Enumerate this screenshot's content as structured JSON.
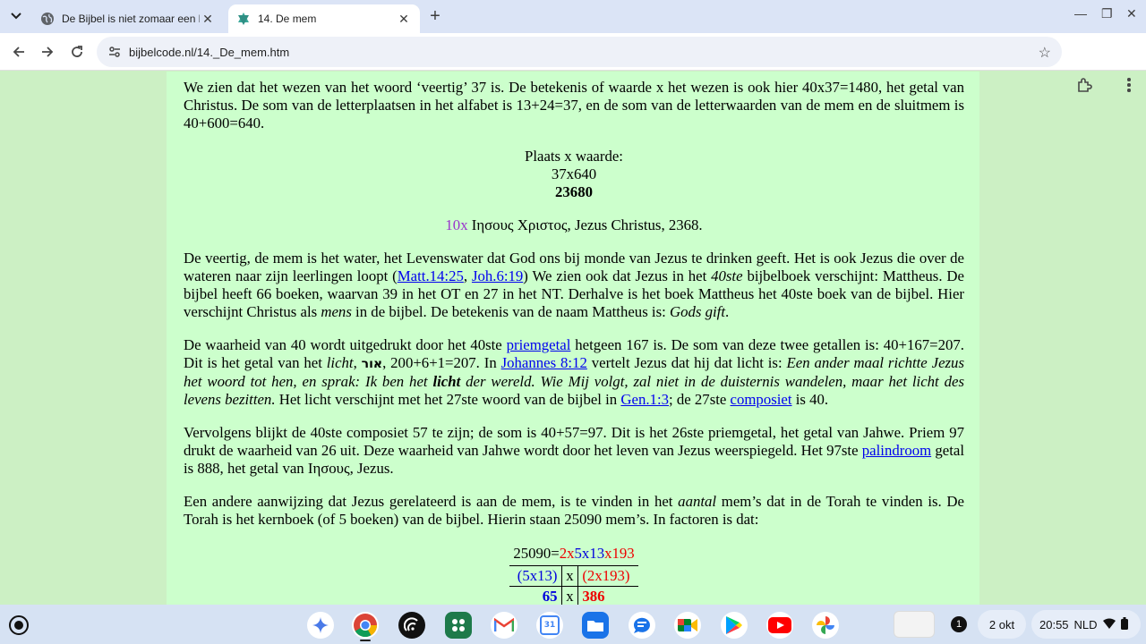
{
  "browser": {
    "tabs": [
      {
        "title": "De Bijbel is niet zomaar een boek"
      },
      {
        "title": "14. De mem"
      }
    ],
    "new_tab": "+",
    "url": "bijbelcode.nl/14._De_mem.htm"
  },
  "article": {
    "p1": "We zien dat het wezen van het woord ‘veertig’ 37 is. De betekenis of waarde x het wezen is ook hier 40x37=1480, het getal van Christus. De som van de letterplaatsen in het alfabet is 13+24=37, en de som van de letterwaarden van de mem en de sluitmem is 40+600=640.",
    "center1": {
      "line1": "Plaats x waarde:",
      "line2": "37x640",
      "line3": "23680"
    },
    "center2": {
      "prefix": "10x",
      "text": " Ιησους Χριστος, Jezus Christus, 2368."
    },
    "p2": {
      "t1": "De veertig, de mem is het water, het Levenswater dat God ons bij monde van Jezus te drinken geeft. Het is ook Jezus die over de wateren naar zijn leerlingen loopt (",
      "link1": "Matt.14:25",
      "t2": ", ",
      "link2": "Joh.6:19",
      "t3": ") We zien ook dat Jezus in het ",
      "em1": "40ste",
      "t4": " bijbelboek verschijnt: Mattheus. De bijbel heeft 66 boeken, waarvan 39 in het OT en 27 in het NT. Derhalve is het boek Mattheus het 40ste boek van de bijbel. Hier verschijnt Christus als ",
      "em2": "mens",
      "t5": " in de bijbel. De betekenis van de naam Mattheus is: ",
      "em3": "Gods gift",
      "t6": "."
    },
    "p3": {
      "t1": "De waarheid van 40 wordt uitgedrukt door het 40ste ",
      "link1": "priemgetal",
      "t2": " hetgeen 167 is. De som van deze twee getallen is: 40+167=207. Dit is het getal van het ",
      "em1": "licht",
      "t3": ", ",
      "hebrew": "אור",
      "t4": ", 200+6+1=207. In ",
      "link2": "Johannes 8:12",
      "t5": " vertelt Jezus dat hij dat licht is: ",
      "em2": "Een ander maal richtte Jezus het woord tot hen, en sprak: Ik ben het ",
      "strong": "licht",
      "em3": " der wereld. Wie Mij volgt, zal niet in de duisternis wandelen, maar het licht des levens bezitten.",
      "t6": " Het licht verschijnt met het 27ste woord van de bijbel in ",
      "link3": "Gen.1:3",
      "t7": "; de 27ste ",
      "link4": "composiet",
      "t8": " is 40."
    },
    "p4": {
      "t1": "Vervolgens blijkt de 40ste composiet 57 te zijn; de som is 40+57=97. Dit is het 26ste priemgetal, het getal van Jahwe. Priem 97 drukt de waarheid van 26 uit. Deze waarheid van Jahwe wordt door het leven van Jezus weerspiegeld. Het 97ste ",
      "link1": "palindroom",
      "t2": " getal is 888, het getal van Ιησους, Jezus."
    },
    "p5": {
      "t1": "Een andere aanwijzing dat Jezus gerelateerd is aan de mem, is te vinden in het ",
      "em1": "aantal",
      "t2": " mem’s dat in de Torah te vinden is. De Torah is het kernboek (of 5 boeken) van de bijbel. Hierin staan 25090 mem’s. In factoren is dat:"
    },
    "factor_table": {
      "top": {
        "a": "25090=",
        "b": "2x",
        "c": "5x13",
        "d": "x193"
      },
      "row2": {
        "left": "(5x13)",
        "mid": "x",
        "right": "(2x193)"
      },
      "row3": {
        "left": "65",
        "mid": "x",
        "right": "386"
      }
    }
  },
  "shelf": {
    "apps": [
      "Gemini",
      "Chrome",
      "Podcasts",
      "Apps",
      "Gmail",
      "Calendar",
      "Files",
      "Messages",
      "Meet",
      "Play Store",
      "YouTube",
      "Photos"
    ],
    "calendar_day": "31",
    "notification_count": "1",
    "date": "2 okt",
    "time": "20:55",
    "locale": "NLD"
  },
  "colors": {
    "page_bg": "#ccffcc",
    "outer_bg": "#ccf0c4",
    "link": "#0000ee",
    "red": "#ee0000",
    "blue": "#0000dd",
    "purple": "#9933cc"
  }
}
